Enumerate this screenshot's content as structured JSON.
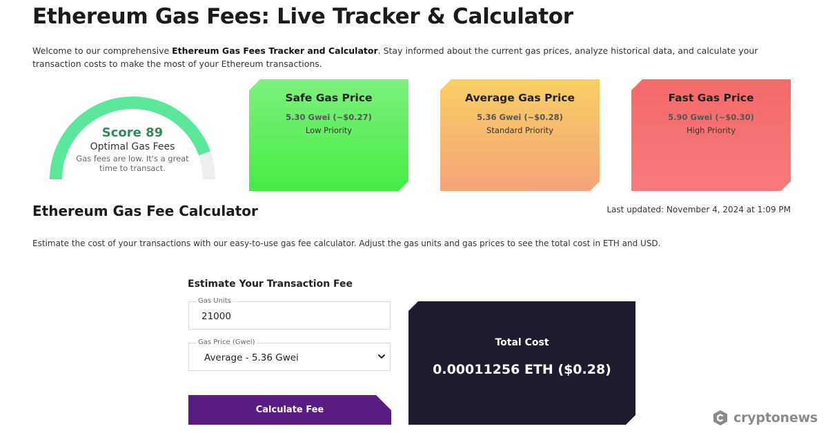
{
  "header": {
    "title": "Ethereum Gas Fees: Live Tracker & Calculator",
    "intro_prefix": "Welcome to our comprehensive ",
    "intro_bold": "Ethereum Gas Fees Tracker and Calculator",
    "intro_suffix": ". Stay informed about the current gas prices, analyze historical data, and calculate your transaction costs to make the most of your Ethereum transactions."
  },
  "gauge": {
    "score_text": "Score 89",
    "score": 89,
    "status": "Optimal Gas Fees",
    "description": "Gas fees are low. It's a great time to transact.",
    "fill_color": "#5be89a",
    "track_color": "#eeeeee"
  },
  "cards": [
    {
      "title": "Safe Gas Price",
      "value": "5.30 Gwei (~$0.27)",
      "priority": "Low Priority"
    },
    {
      "title": "Average Gas Price",
      "value": "5.36 Gwei (~$0.28)",
      "priority": "Standard Priority"
    },
    {
      "title": "Fast Gas Price",
      "value": "5.90 Gwei (~$0.30)",
      "priority": "High Priority"
    }
  ],
  "calculator": {
    "title": "Ethereum Gas Fee Calculator",
    "last_updated": "Last updated: November 4, 2024 at 1:09 PM",
    "description": "Estimate the cost of your transactions with our easy-to-use gas fee calculator. Adjust the gas units and gas prices to see the total cost in ETH and USD.",
    "estimate_title": "Estimate Your Transaction Fee",
    "gas_units_label": "Gas Units",
    "gas_units_value": "21000",
    "gas_price_label": "Gas Price (Gwei)",
    "gas_price_selected": "Average - 5.36 Gwei",
    "button_label": "Calculate Fee",
    "total_label": "Total Cost",
    "total_value": "0.00011256 ETH ($0.28)"
  },
  "brand": {
    "name": "cryptonews",
    "icon": "cryptonews-logo-icon"
  },
  "colors": {
    "button": "#5a1b82",
    "total_panel": "#1e1b2e",
    "score_text": "#2e8b57"
  }
}
